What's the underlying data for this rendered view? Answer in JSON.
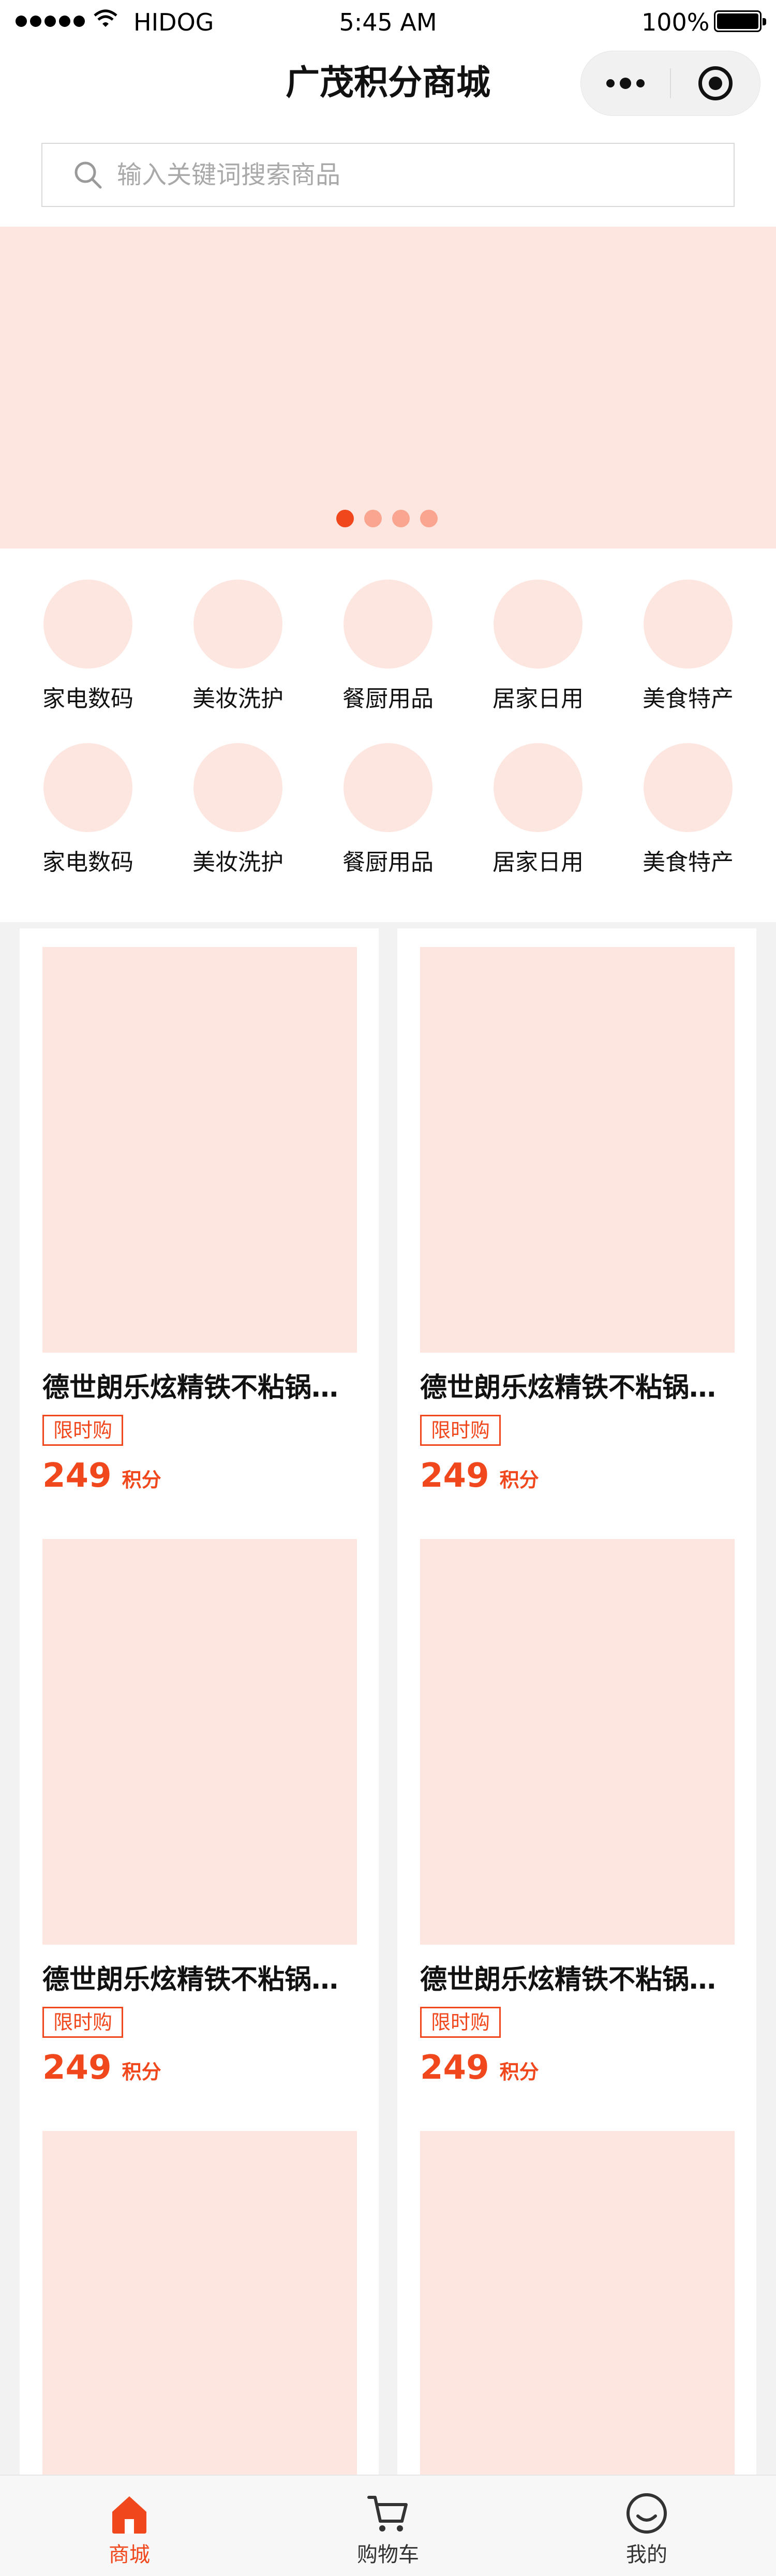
{
  "status_bar": {
    "carrier": "HIDOG",
    "time": "5:45 AM",
    "battery": "100%"
  },
  "nav": {
    "title": "广茂积分商城"
  },
  "search": {
    "placeholder": "输入关键词搜索商品"
  },
  "banner": {
    "slides": 4,
    "active_index": 0
  },
  "categories": [
    {
      "label": "家电数码"
    },
    {
      "label": "美妆洗护"
    },
    {
      "label": "餐厨用品"
    },
    {
      "label": "居家日用"
    },
    {
      "label": "美食特产"
    },
    {
      "label": "家电数码"
    },
    {
      "label": "美妆洗护"
    },
    {
      "label": "餐厨用品"
    },
    {
      "label": "居家日用"
    },
    {
      "label": "美食特产"
    }
  ],
  "products": [
    {
      "title": "德世朗乐炫精铁不粘锅三…",
      "tag": "限时购",
      "price": "249",
      "unit": "积分"
    },
    {
      "title": "德世朗乐炫精铁不粘锅三…",
      "tag": "限时购",
      "price": "249",
      "unit": "积分"
    },
    {
      "title": "德世朗乐炫精铁不粘锅三…",
      "tag": "限时购",
      "price": "249",
      "unit": "积分"
    },
    {
      "title": "德世朗乐炫精铁不粘锅三…",
      "tag": "限时购",
      "price": "249",
      "unit": "积分"
    },
    {
      "title": "",
      "tag": "",
      "price": "",
      "unit": ""
    },
    {
      "title": "",
      "tag": "",
      "price": "",
      "unit": ""
    }
  ],
  "tabbar": {
    "items": [
      {
        "label": "商城",
        "icon": "home-icon",
        "active": true
      },
      {
        "label": "购物车",
        "icon": "cart-icon",
        "active": false
      },
      {
        "label": "我的",
        "icon": "smile-icon",
        "active": false
      }
    ]
  },
  "colors": {
    "accent": "#f1471d",
    "placeholder_pink": "#fde5e0",
    "page_gray": "#f2f2f2"
  }
}
